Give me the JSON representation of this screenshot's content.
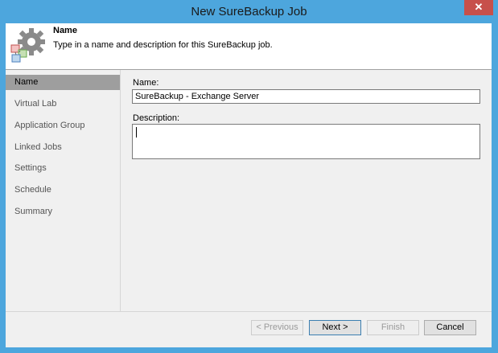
{
  "window": {
    "title": "New SureBackup Job",
    "close_glyph": "✕"
  },
  "header": {
    "title": "Name",
    "description": "Type in a name and description for this SureBackup job.",
    "icon": "gear-settings-icon"
  },
  "sidebar": {
    "items": [
      {
        "label": "Name",
        "active": true
      },
      {
        "label": "Virtual Lab",
        "active": false
      },
      {
        "label": "Application Group",
        "active": false
      },
      {
        "label": "Linked Jobs",
        "active": false
      },
      {
        "label": "Settings",
        "active": false
      },
      {
        "label": "Schedule",
        "active": false
      },
      {
        "label": "Summary",
        "active": false
      }
    ]
  },
  "form": {
    "name_label": "Name:",
    "name_value": "SureBackup - Exchange Server",
    "description_label": "Description:",
    "description_value": ""
  },
  "footer": {
    "previous_label": "< Previous",
    "next_label": "Next >",
    "finish_label": "Finish",
    "cancel_label": "Cancel"
  },
  "colors": {
    "window_frame": "#4da6dd",
    "close_button": "#c7504b",
    "active_nav": "#9e9e9e"
  }
}
